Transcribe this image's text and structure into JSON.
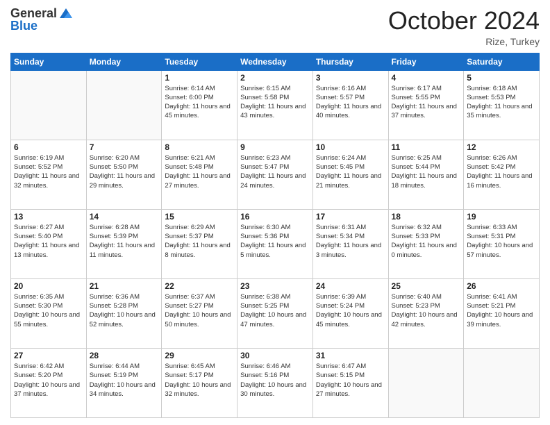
{
  "header": {
    "logo_general": "General",
    "logo_blue": "Blue",
    "month_title": "October 2024",
    "location": "Rize, Turkey"
  },
  "days_of_week": [
    "Sunday",
    "Monday",
    "Tuesday",
    "Wednesday",
    "Thursday",
    "Friday",
    "Saturday"
  ],
  "weeks": [
    [
      {
        "day": "",
        "info": ""
      },
      {
        "day": "",
        "info": ""
      },
      {
        "day": "1",
        "info": "Sunrise: 6:14 AM\nSunset: 6:00 PM\nDaylight: 11 hours and 45 minutes."
      },
      {
        "day": "2",
        "info": "Sunrise: 6:15 AM\nSunset: 5:58 PM\nDaylight: 11 hours and 43 minutes."
      },
      {
        "day": "3",
        "info": "Sunrise: 6:16 AM\nSunset: 5:57 PM\nDaylight: 11 hours and 40 minutes."
      },
      {
        "day": "4",
        "info": "Sunrise: 6:17 AM\nSunset: 5:55 PM\nDaylight: 11 hours and 37 minutes."
      },
      {
        "day": "5",
        "info": "Sunrise: 6:18 AM\nSunset: 5:53 PM\nDaylight: 11 hours and 35 minutes."
      }
    ],
    [
      {
        "day": "6",
        "info": "Sunrise: 6:19 AM\nSunset: 5:52 PM\nDaylight: 11 hours and 32 minutes."
      },
      {
        "day": "7",
        "info": "Sunrise: 6:20 AM\nSunset: 5:50 PM\nDaylight: 11 hours and 29 minutes."
      },
      {
        "day": "8",
        "info": "Sunrise: 6:21 AM\nSunset: 5:48 PM\nDaylight: 11 hours and 27 minutes."
      },
      {
        "day": "9",
        "info": "Sunrise: 6:23 AM\nSunset: 5:47 PM\nDaylight: 11 hours and 24 minutes."
      },
      {
        "day": "10",
        "info": "Sunrise: 6:24 AM\nSunset: 5:45 PM\nDaylight: 11 hours and 21 minutes."
      },
      {
        "day": "11",
        "info": "Sunrise: 6:25 AM\nSunset: 5:44 PM\nDaylight: 11 hours and 18 minutes."
      },
      {
        "day": "12",
        "info": "Sunrise: 6:26 AM\nSunset: 5:42 PM\nDaylight: 11 hours and 16 minutes."
      }
    ],
    [
      {
        "day": "13",
        "info": "Sunrise: 6:27 AM\nSunset: 5:40 PM\nDaylight: 11 hours and 13 minutes."
      },
      {
        "day": "14",
        "info": "Sunrise: 6:28 AM\nSunset: 5:39 PM\nDaylight: 11 hours and 11 minutes."
      },
      {
        "day": "15",
        "info": "Sunrise: 6:29 AM\nSunset: 5:37 PM\nDaylight: 11 hours and 8 minutes."
      },
      {
        "day": "16",
        "info": "Sunrise: 6:30 AM\nSunset: 5:36 PM\nDaylight: 11 hours and 5 minutes."
      },
      {
        "day": "17",
        "info": "Sunrise: 6:31 AM\nSunset: 5:34 PM\nDaylight: 11 hours and 3 minutes."
      },
      {
        "day": "18",
        "info": "Sunrise: 6:32 AM\nSunset: 5:33 PM\nDaylight: 11 hours and 0 minutes."
      },
      {
        "day": "19",
        "info": "Sunrise: 6:33 AM\nSunset: 5:31 PM\nDaylight: 10 hours and 57 minutes."
      }
    ],
    [
      {
        "day": "20",
        "info": "Sunrise: 6:35 AM\nSunset: 5:30 PM\nDaylight: 10 hours and 55 minutes."
      },
      {
        "day": "21",
        "info": "Sunrise: 6:36 AM\nSunset: 5:28 PM\nDaylight: 10 hours and 52 minutes."
      },
      {
        "day": "22",
        "info": "Sunrise: 6:37 AM\nSunset: 5:27 PM\nDaylight: 10 hours and 50 minutes."
      },
      {
        "day": "23",
        "info": "Sunrise: 6:38 AM\nSunset: 5:25 PM\nDaylight: 10 hours and 47 minutes."
      },
      {
        "day": "24",
        "info": "Sunrise: 6:39 AM\nSunset: 5:24 PM\nDaylight: 10 hours and 45 minutes."
      },
      {
        "day": "25",
        "info": "Sunrise: 6:40 AM\nSunset: 5:23 PM\nDaylight: 10 hours and 42 minutes."
      },
      {
        "day": "26",
        "info": "Sunrise: 6:41 AM\nSunset: 5:21 PM\nDaylight: 10 hours and 39 minutes."
      }
    ],
    [
      {
        "day": "27",
        "info": "Sunrise: 6:42 AM\nSunset: 5:20 PM\nDaylight: 10 hours and 37 minutes."
      },
      {
        "day": "28",
        "info": "Sunrise: 6:44 AM\nSunset: 5:19 PM\nDaylight: 10 hours and 34 minutes."
      },
      {
        "day": "29",
        "info": "Sunrise: 6:45 AM\nSunset: 5:17 PM\nDaylight: 10 hours and 32 minutes."
      },
      {
        "day": "30",
        "info": "Sunrise: 6:46 AM\nSunset: 5:16 PM\nDaylight: 10 hours and 30 minutes."
      },
      {
        "day": "31",
        "info": "Sunrise: 6:47 AM\nSunset: 5:15 PM\nDaylight: 10 hours and 27 minutes."
      },
      {
        "day": "",
        "info": ""
      },
      {
        "day": "",
        "info": ""
      }
    ]
  ]
}
